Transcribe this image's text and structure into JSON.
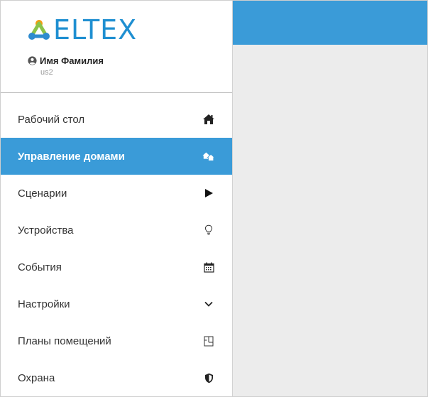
{
  "brand": {
    "name": "ELTEX"
  },
  "user": {
    "name": "Имя Фамилия",
    "login": "us2"
  },
  "menu": {
    "items": [
      {
        "label": "Рабочий стол",
        "icon": "home-icon",
        "active": false
      },
      {
        "label": "Управление домами",
        "icon": "houses-icon",
        "active": true
      },
      {
        "label": "Сценарии",
        "icon": "play-icon",
        "active": false
      },
      {
        "label": "Устройства",
        "icon": "lightbulb-icon",
        "active": false
      },
      {
        "label": "События",
        "icon": "calendar-icon",
        "active": false
      },
      {
        "label": "Настройки",
        "icon": "chevron-down-icon",
        "active": false
      },
      {
        "label": "Планы помещений",
        "icon": "floor-plan-icon",
        "active": false
      },
      {
        "label": "Охрана",
        "icon": "shield-icon",
        "active": false
      }
    ]
  },
  "colors": {
    "accent": "#3a9bd8",
    "logo": "#1f8fd1",
    "background": "#ececec"
  }
}
